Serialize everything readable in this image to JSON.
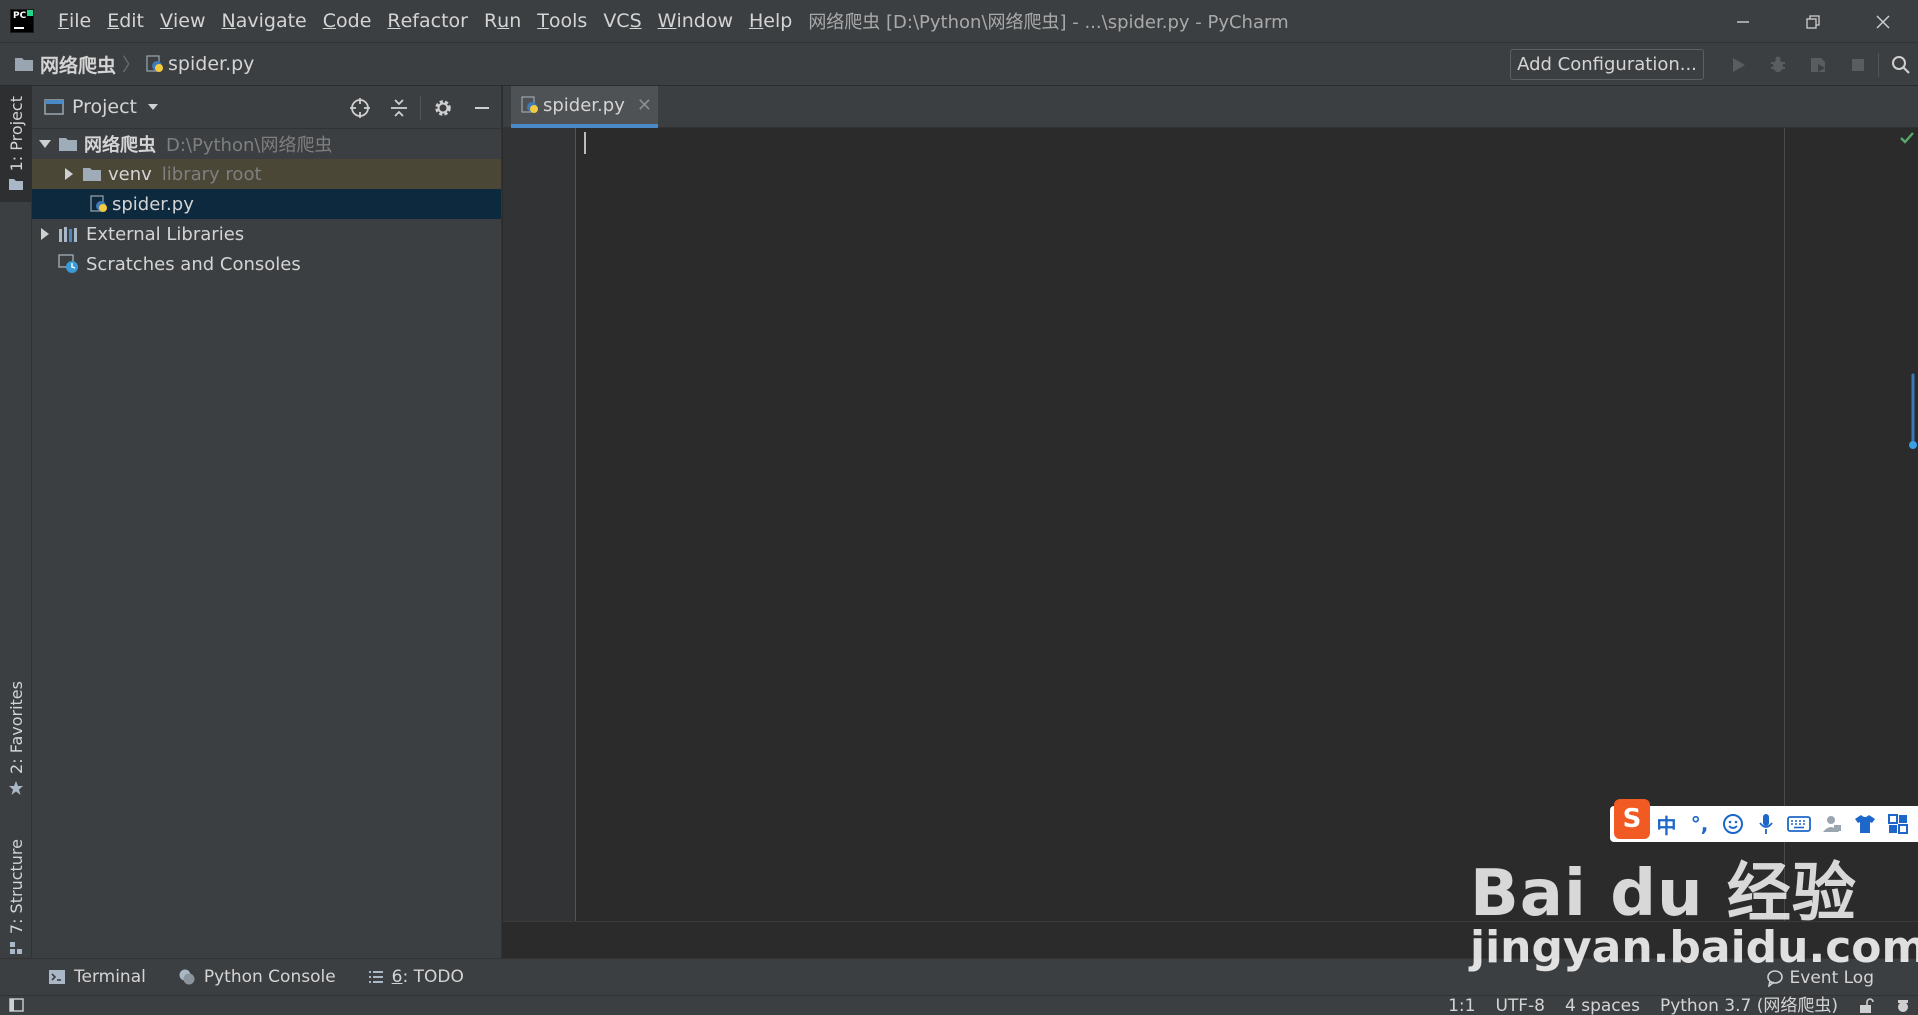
{
  "app": {
    "window_title": "网络爬虫 [D:\\Python\\网络爬虫] - ...\\spider.py - PyCharm",
    "logo_text": "PC"
  },
  "menu": {
    "items": [
      {
        "pre": "",
        "u": "F",
        "post": "ile"
      },
      {
        "pre": "",
        "u": "E",
        "post": "dit"
      },
      {
        "pre": "",
        "u": "V",
        "post": "iew"
      },
      {
        "pre": "",
        "u": "N",
        "post": "avigate"
      },
      {
        "pre": "",
        "u": "C",
        "post": "ode"
      },
      {
        "pre": "",
        "u": "R",
        "post": "efactor"
      },
      {
        "pre": "R",
        "u": "u",
        "post": "n"
      },
      {
        "pre": "",
        "u": "T",
        "post": "ools"
      },
      {
        "pre": "VC",
        "u": "S",
        "post": ""
      },
      {
        "pre": "",
        "u": "W",
        "post": "indow"
      },
      {
        "pre": "",
        "u": "H",
        "post": "elp"
      }
    ]
  },
  "navbar": {
    "project_crumb": "网络爬虫",
    "file_crumb": "spider.py",
    "add_configuration": "Add Configuration..."
  },
  "left_strip": {
    "project_tab": "1: Project",
    "favorites_tab": "2: Favorites",
    "structure_tab": "7: Structure"
  },
  "project_panel": {
    "title": "Project",
    "tree": {
      "root_name": "网络爬虫",
      "root_path": "D:\\Python\\网络爬虫",
      "venv_name": "venv",
      "venv_hint": "library root",
      "file_name": "spider.py",
      "external_libraries": "External Libraries",
      "scratches": "Scratches and Consoles"
    }
  },
  "editor": {
    "tab_label": "spider.py",
    "tab_close": "✕"
  },
  "tool_windows": {
    "terminal": "Terminal",
    "python_console": "Python Console",
    "todo_num": "6",
    "todo_label": ": TODO",
    "event_log": "Event Log"
  },
  "status": {
    "position": "1:1",
    "encoding": "UTF-8",
    "indent": "4 spaces",
    "interpreter": "Python 3.7 (网络爬虫)"
  },
  "ime": {
    "logo": "S",
    "lang": "中",
    "punct": "°,"
  },
  "watermark": {
    "brand": "Bai du 经验",
    "site": "jingyan.baidu.com"
  },
  "colors": {
    "accent": "#4a88c7",
    "selection": "#0d293e",
    "library_root_bg": "#4a4737",
    "success": "#59a869"
  }
}
